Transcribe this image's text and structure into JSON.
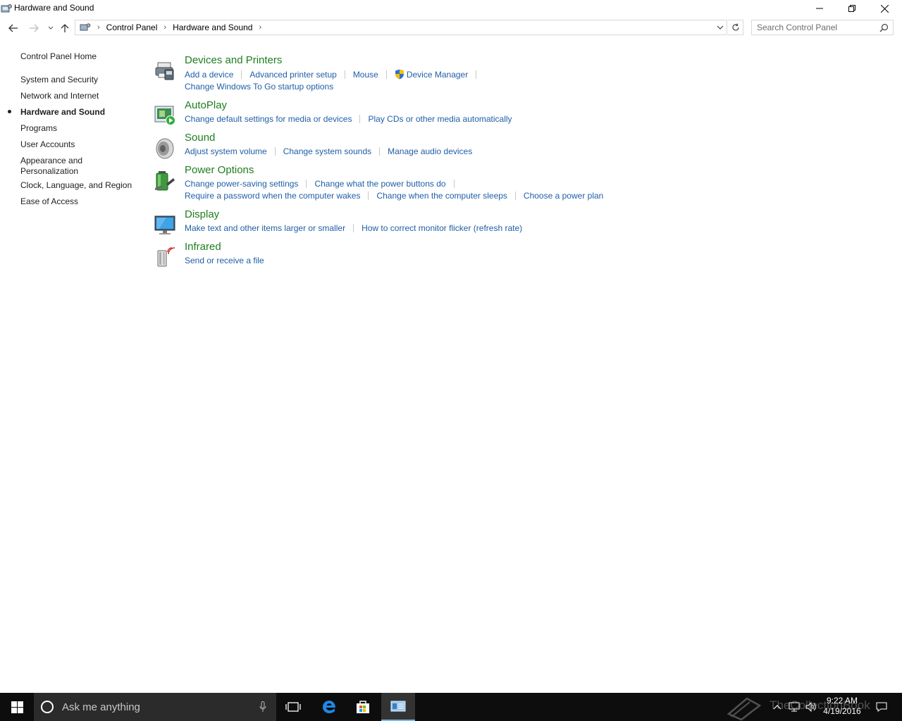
{
  "window": {
    "title": "Hardware and Sound"
  },
  "address": {
    "crumbs": [
      "Control Panel",
      "Hardware and Sound"
    ]
  },
  "search": {
    "placeholder": "Search Control Panel"
  },
  "sidebar": {
    "home": "Control Panel Home",
    "items": [
      {
        "label": "System and Security"
      },
      {
        "label": "Network and Internet"
      },
      {
        "label": "Hardware and Sound",
        "active": true
      },
      {
        "label": "Programs"
      },
      {
        "label": "User Accounts"
      },
      {
        "label": "Appearance and Personalization"
      },
      {
        "label": "Clock, Language, and Region"
      },
      {
        "label": "Ease of Access"
      }
    ]
  },
  "categories": [
    {
      "title": "Devices and Printers",
      "icon": "printer-icon",
      "links": [
        [
          "Add a device",
          "Advanced printer setup",
          "Mouse",
          "Device Manager"
        ],
        [
          "Change Windows To Go startup options"
        ]
      ]
    },
    {
      "title": "AutoPlay",
      "icon": "autoplay-icon",
      "links": [
        [
          "Change default settings for media or devices",
          "Play CDs or other media automatically"
        ]
      ]
    },
    {
      "title": "Sound",
      "icon": "speaker-icon",
      "links": [
        [
          "Adjust system volume",
          "Change system sounds",
          "Manage audio devices"
        ]
      ]
    },
    {
      "title": "Power Options",
      "icon": "battery-icon",
      "links": [
        [
          "Change power-saving settings",
          "Change what the power buttons do"
        ],
        [
          "Require a password when the computer wakes",
          "Change when the computer sleeps",
          "Choose a power plan"
        ]
      ]
    },
    {
      "title": "Display",
      "icon": "monitor-icon",
      "links": [
        [
          "Make text and other items larger or smaller",
          "How to correct monitor flicker (refresh rate)"
        ]
      ]
    },
    {
      "title": "Infrared",
      "icon": "infrared-icon",
      "links": [
        [
          "Send or receive a file"
        ]
      ]
    }
  ],
  "taskbar": {
    "search_placeholder": "Ask me anything",
    "time": "9:22 AM",
    "date": "4/19/2016"
  },
  "watermark": {
    "text": "TheCollectionBook"
  },
  "colors": {
    "category_title": "#1e7e1e",
    "link": "#1f5fa6",
    "taskbar": "#0d0d0d",
    "accent": "#76b9ed"
  }
}
